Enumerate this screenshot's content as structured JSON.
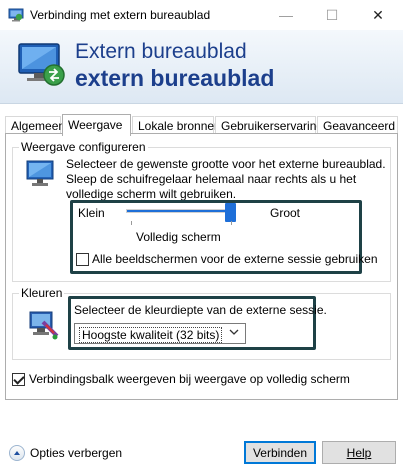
{
  "window": {
    "title": "Verbinding met extern bureaublad",
    "minimize_glyph": "—",
    "maximize_glyph": "☐",
    "close_glyph": "✕"
  },
  "banner": {
    "line1": "Extern bureaublad",
    "line2": "extern bureaublad",
    "icon": "remote-desktop-icon"
  },
  "tabs": [
    {
      "label": "Algemeen",
      "active": false
    },
    {
      "label": "Weergave",
      "active": true
    },
    {
      "label": "Lokale bronnen",
      "active": false
    },
    {
      "label": "Gebruikerservaring",
      "active": false
    },
    {
      "label": "Geavanceerd",
      "active": false
    }
  ],
  "display_group": {
    "legend": "Weergave configureren",
    "description": "Selecteer de gewenste grootte voor het externe bureaublad. Sleep de schuifregelaar helemaal naar rechts als u het volledige scherm wilt gebruiken.",
    "slider_min_label": "Klein",
    "slider_max_label": "Groot",
    "slider_value": 1.0,
    "slider_value_label": "Volledig scherm",
    "all_monitors_label": "Alle beeldschermen voor de externe sessie gebruiken",
    "all_monitors_checked": false
  },
  "colors_group": {
    "legend": "Kleuren",
    "description": "Selecteer de kleurdiepte van de externe sessie.",
    "color_depth_selected": "Hoogste kwaliteit (32 bits)"
  },
  "connection_bar": {
    "label": "Verbindingsbalk weergeven bij weergave op volledig scherm",
    "checked": true
  },
  "footer": {
    "options_label": "Opties verbergen",
    "connect_label": "Verbinden",
    "help_label": "Help"
  },
  "colors": {
    "accent": "#1e6fd8",
    "banner_text": "#1c3f8c",
    "highlight_border": "#1e4146"
  }
}
